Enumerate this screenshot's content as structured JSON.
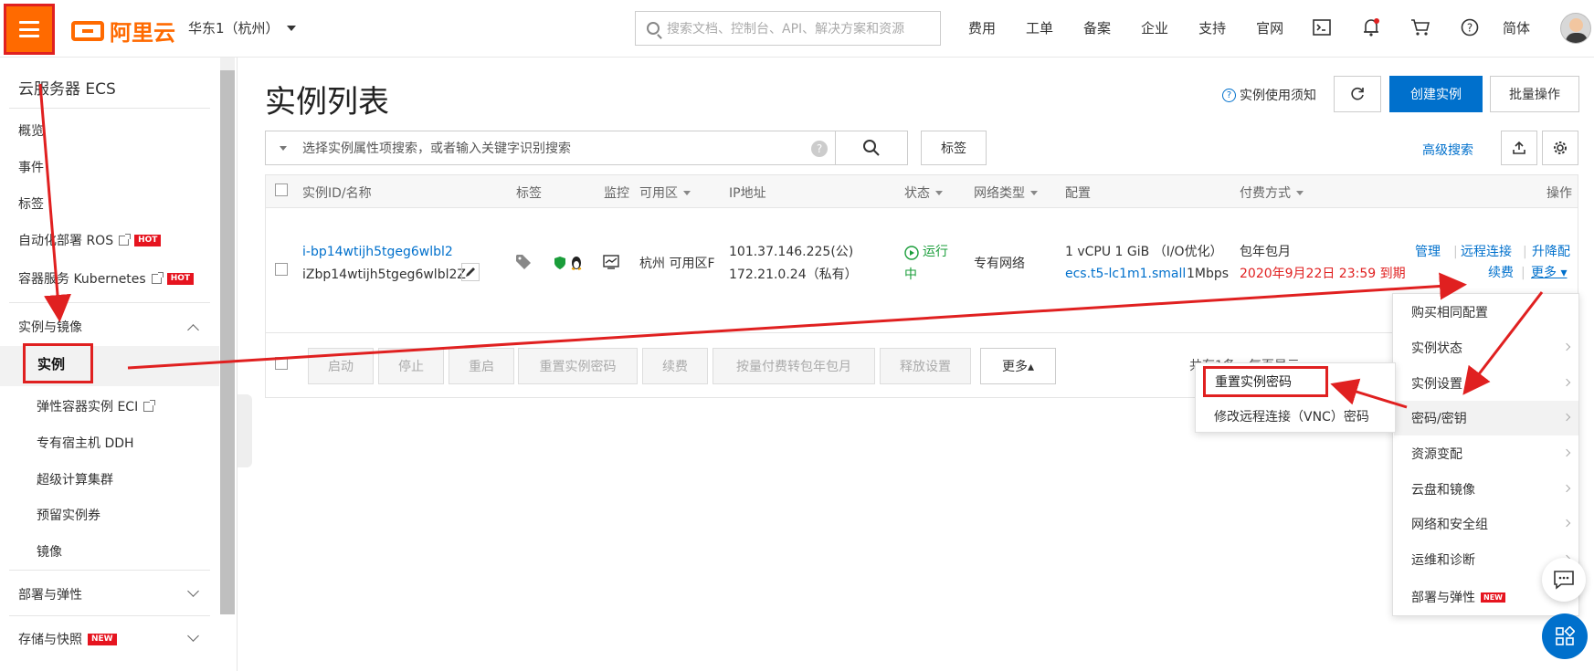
{
  "topbar": {
    "logo_text": "阿里云",
    "region": "华东1（杭州）",
    "search_placeholder": "搜索文档、控制台、API、解决方案和资源",
    "nav": [
      "费用",
      "工单",
      "备案",
      "企业",
      "支持",
      "官网"
    ],
    "lang": "简体",
    "icons": [
      "terminal-icon",
      "bell-icon",
      "cart-icon",
      "help-icon"
    ]
  },
  "sidebar": {
    "title": "云服务器 ECS",
    "items": [
      {
        "label": "概览"
      },
      {
        "label": "事件"
      },
      {
        "label": "标签"
      },
      {
        "label": "自动化部署 ROS",
        "hot": "HOT"
      },
      {
        "label": "容器服务 Kubernetes",
        "hot": "HOT"
      }
    ],
    "group_instances": "实例与镜像",
    "sub_items": [
      {
        "label": "实例"
      },
      {
        "label": "弹性容器实例 ECI"
      },
      {
        "label": "专有宿主机 DDH"
      },
      {
        "label": "超级计算集群"
      },
      {
        "label": "预留实例券"
      },
      {
        "label": "镜像"
      }
    ],
    "group_deploy": "部署与弹性",
    "group_storage": "存储与快照",
    "new_badge": "NEW"
  },
  "main": {
    "title": "实例列表",
    "notice": "实例使用须知",
    "create_label": "创建实例",
    "batch_label": "批量操作",
    "filter_placeholder": "选择实例属性项搜索，或者输入关键字识别搜索",
    "tag_label": "标签",
    "advanced_search": "高级搜索"
  },
  "table": {
    "headers": [
      "实例ID/名称",
      "标签",
      "监控",
      "可用区",
      "IP地址",
      "状态",
      "网络类型",
      "配置",
      "付费方式",
      "操作"
    ],
    "row": {
      "instance_id": "i-bp14wtijh5tgeg6wlbl2",
      "instance_name": "iZbp14wtijh5tgeg6wlbl2Z",
      "zone": "杭州 可用区F",
      "ip_public": "101.37.146.225(公)",
      "ip_private": "172.21.0.24（私有）",
      "status_line1": "运行",
      "status_line2": "中",
      "network": "专有网络",
      "config_line1": "1 vCPU 1 GiB （I/O优化）",
      "config_type": "ecs.t5-lc1m1.small",
      "config_bw": "1Mbps",
      "billing": "包年包月",
      "expire": "2020年9月22日 23:59 到期",
      "action_manage": "管理",
      "action_remote": "远程连接",
      "action_upgrade": "升降配",
      "action_renew": "续费",
      "action_more": "更多"
    },
    "footer_buttons": [
      "启动",
      "停止",
      "重启",
      "重置实例密码",
      "续费",
      "按量付费转包年包月",
      "释放设置"
    ],
    "footer_more": "更多▴",
    "pager_text": "共有1条，每页显示"
  },
  "more_menu": {
    "items": [
      "购买相同配置",
      "实例状态",
      "实例设置",
      "密码/密钥",
      "资源变配",
      "云盘和镜像",
      "网络和安全组",
      "运维和诊断",
      "部署与弹性"
    ],
    "new_badge": "NEW"
  },
  "password_submenu": {
    "items": [
      "重置实例密码",
      "修改远程连接（VNC）密码"
    ]
  },
  "colors": {
    "brand": "#ff6a00",
    "primary": "#0070cc",
    "annotation_red": "#e02020"
  }
}
